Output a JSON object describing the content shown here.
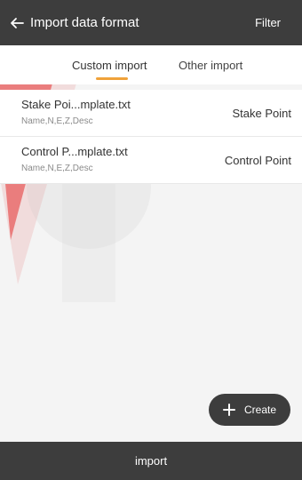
{
  "header": {
    "title": "Import data format",
    "filter_label": "Filter"
  },
  "tabs": [
    {
      "label": "Custom import",
      "active": true
    },
    {
      "label": "Other import",
      "active": false
    }
  ],
  "templates": [
    {
      "name": "Stake Poi...mplate.txt",
      "fields": "Name,N,E,Z,Desc",
      "type": "Stake Point"
    },
    {
      "name": "Control P...mplate.txt",
      "fields": "Name,N,E,Z,Desc",
      "type": "Control Point"
    }
  ],
  "create_button": {
    "label": "Create",
    "icon": "plus-icon"
  },
  "footer": {
    "import_label": "import"
  },
  "colors": {
    "bar": "#3d3d3d",
    "accent": "#f0a23a",
    "watermark": "#e11b1b"
  },
  "icons": {
    "back": "arrow-left-icon"
  }
}
